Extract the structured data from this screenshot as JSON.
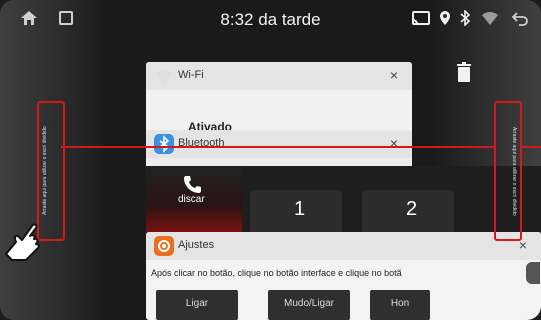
{
  "status_bar": {
    "time": "8:32 da tarde",
    "icons": [
      "home-icon",
      "recents-icon",
      "cast-icon",
      "location-icon",
      "bluetooth-icon",
      "wifi-icon",
      "back-icon"
    ]
  },
  "recent_apps": {
    "wifi": {
      "title": "Wi-Fi",
      "status": "Ativado"
    },
    "bluetooth": {
      "title": "Bluetooth"
    },
    "phone": {
      "dial_label": "discar",
      "keys": [
        "1",
        "2"
      ]
    },
    "settings": {
      "title": "Ajustes",
      "instruction": "Após clicar no botão, clique no botão interface e clique no botã",
      "buttons": [
        "Ligar",
        "Mudo/Ligar",
        "Hon"
      ]
    }
  },
  "hint": {
    "left_text": "Arraste aqui para utilizar o escri dividido",
    "right_text": "Arraste aqui para utilizar o escri dividido"
  },
  "close_symbol": "×",
  "colors": {
    "highlight": "#d21a1a",
    "bluetooth": "#3d8fe6",
    "settings": "#ea6f21"
  }
}
